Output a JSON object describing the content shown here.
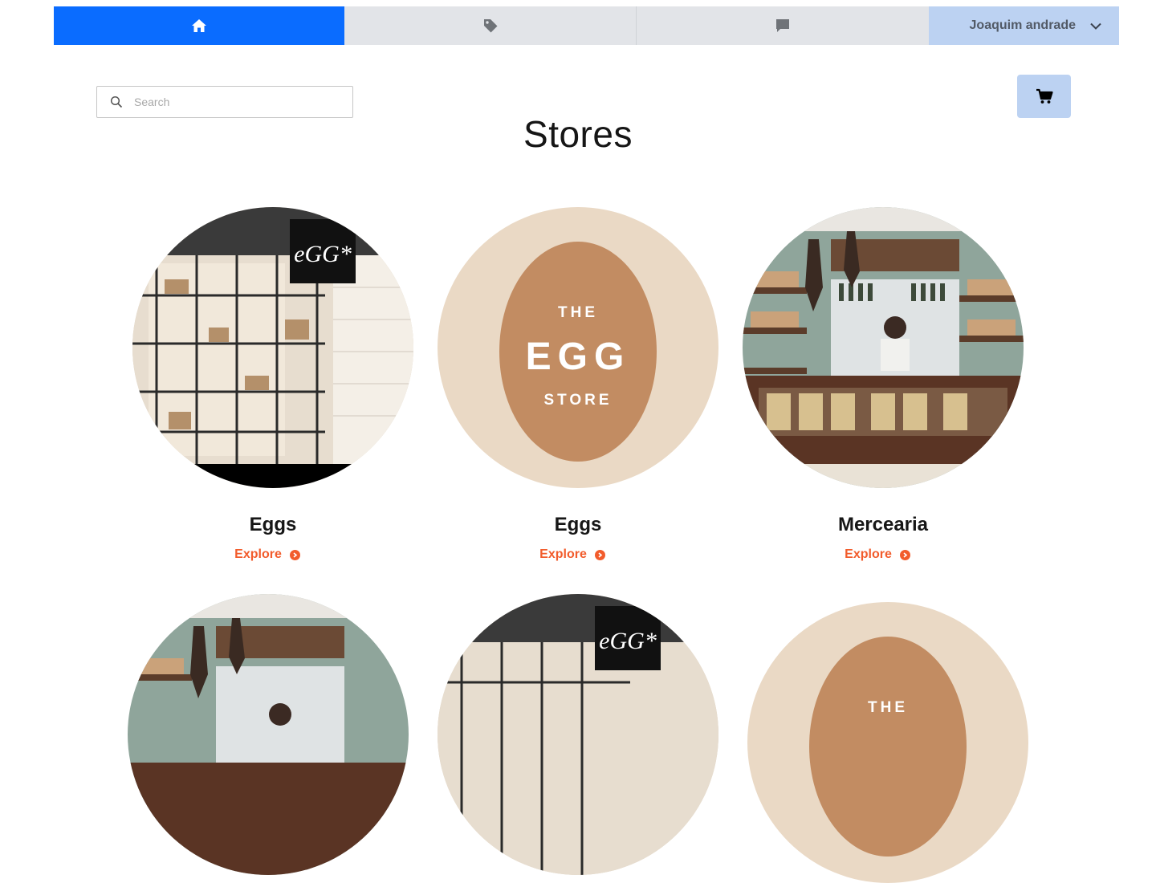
{
  "nav": {
    "tabs": [
      {
        "icon": "home-icon",
        "active": true
      },
      {
        "icon": "tag-icon",
        "active": false
      },
      {
        "icon": "chat-icon",
        "active": false
      }
    ],
    "user_name": "Joaquim andrade",
    "user_menu_icon": "chevron-down-icon"
  },
  "search": {
    "placeholder": "Search",
    "value": ""
  },
  "cart": {
    "icon": "cart-icon"
  },
  "page_title": "Stores",
  "stores": [
    {
      "name": "Eggs",
      "action": "Explore",
      "image": "egg-storefront-photo"
    },
    {
      "name": "Eggs",
      "action": "Explore",
      "image": "the-egg-store-logo"
    },
    {
      "name": "Mercearia",
      "action": "Explore",
      "image": "grocery-counter-photo"
    },
    {
      "image": "grocery-counter-photo"
    },
    {
      "image": "egg-storefront-photo"
    },
    {
      "image": "the-egg-store-logo"
    }
  ],
  "logo_text": {
    "egg_sign": "eGG*",
    "the": "THE",
    "egg": "EGG",
    "store": "STORE"
  },
  "colors": {
    "primary": "#0a6cff",
    "nav_tab": "#e2e4e8",
    "user_bg": "#bcd2f2",
    "explore": "#f25c2c",
    "egg_bg": "#ead9c5",
    "egg": "#c28c62"
  }
}
